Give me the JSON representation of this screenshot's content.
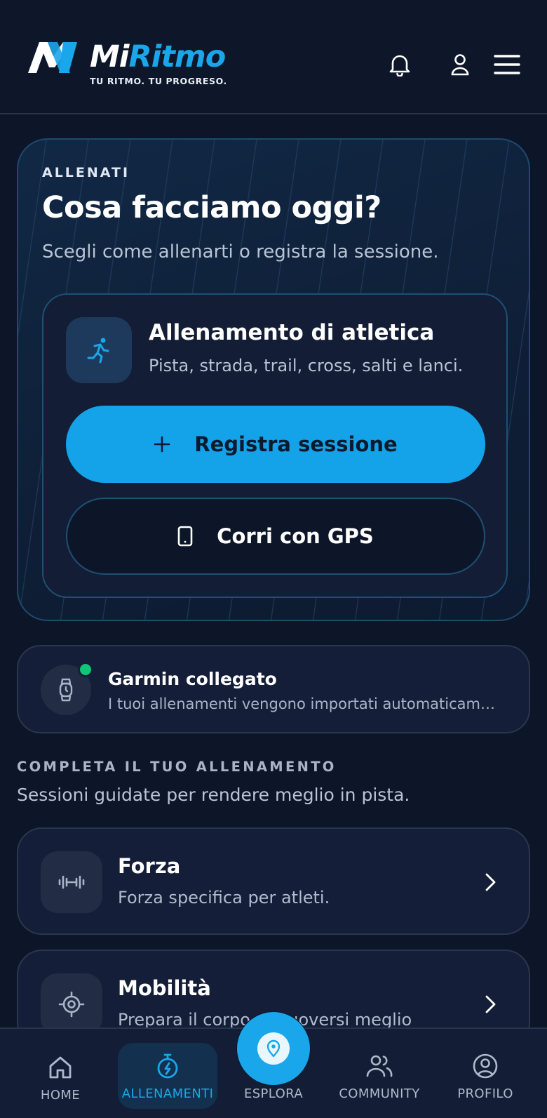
{
  "header": {
    "brand_mi": "Mi",
    "brand_ritmo": "Ritmo",
    "tagline": "TU RITMO. TU PROGRESO.",
    "icons": [
      "bell-icon",
      "user-icon",
      "menu-icon"
    ]
  },
  "hero": {
    "eyebrow": "ALLENATI",
    "title": "Cosa facciamo oggi?",
    "subtitle": "Scegli come allenarti o registra la sessione.",
    "activity": {
      "icon": "runner-icon",
      "title": "Allenamento di atletica",
      "subtitle": "Pista, strada, trail, cross, salti e lanci."
    },
    "primary_button": {
      "icon": "plus-icon",
      "label": "Registra sessione"
    },
    "secondary_button": {
      "icon": "phone-icon",
      "label": "Corri con GPS"
    }
  },
  "device": {
    "icon": "watch-icon",
    "status_color": "#12c47a",
    "title": "Garmin collegato",
    "subtitle": "I tuoi allenamenti vengono importati automaticam…"
  },
  "section": {
    "eyebrow": "COMPLETA IL TUO ALLENAMENTO",
    "subtitle": "Sessioni guidate per rendere meglio in pista."
  },
  "sessions": [
    {
      "icon": "dumbbell-icon",
      "title": "Forza",
      "subtitle": "Forza specifica per atleti."
    },
    {
      "icon": "target-icon",
      "title": "Mobilità",
      "subtitle": "Prepara il corpo a muoversi meglio"
    }
  ],
  "nav": {
    "items": [
      {
        "icon": "home-icon",
        "label": "HOME"
      },
      {
        "icon": "stopwatch-icon",
        "label": "ALLENAMENTI",
        "active": true
      },
      {
        "icon": "map-pin-icon",
        "label": "ESPLORA"
      },
      {
        "icon": "community-icon",
        "label": "COMMUNITY"
      },
      {
        "icon": "profile-icon",
        "label": "PROFILO"
      }
    ]
  },
  "colors": {
    "background": "#0d1628",
    "accent": "#14a3e8",
    "card": "#151e38",
    "text_muted": "#b8c3d3"
  }
}
